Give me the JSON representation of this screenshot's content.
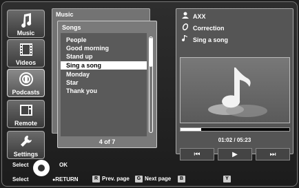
{
  "sidebar": {
    "items": [
      {
        "label": "Music",
        "icon": "music-note-icon"
      },
      {
        "label": "Videos",
        "icon": "film-icon"
      },
      {
        "label": "Podcasts",
        "icon": "podcast-icon"
      },
      {
        "label": "Remote",
        "icon": "remote-icon"
      },
      {
        "label": "Settings",
        "icon": "wrench-icon"
      }
    ]
  },
  "back_panel": {
    "title": "Music"
  },
  "songs_panel": {
    "title": "Songs",
    "items": [
      "People",
      "Good morning",
      "Stand up",
      "Sing a song",
      "Monday",
      "Star",
      "Thank you"
    ],
    "selected_index": 3,
    "pager": "4 of 7"
  },
  "now_playing": {
    "artist": "AXX",
    "album": "Correction",
    "song": "Sing a song",
    "time": "01:02 / 05:23",
    "progress": 0.19
  },
  "help": {
    "select_ok": "Select",
    "ok": "OK",
    "select_return": "Select",
    "return": "RETURN",
    "r_key": "R",
    "prev_page": "Prev. page",
    "g_key": "G",
    "next_page": "Next page",
    "b_key": "B",
    "y_key": "Y"
  },
  "colors": {
    "accent": "#ffffff",
    "panel": "#7a7a7a",
    "selected_bg": "#ffffff"
  }
}
